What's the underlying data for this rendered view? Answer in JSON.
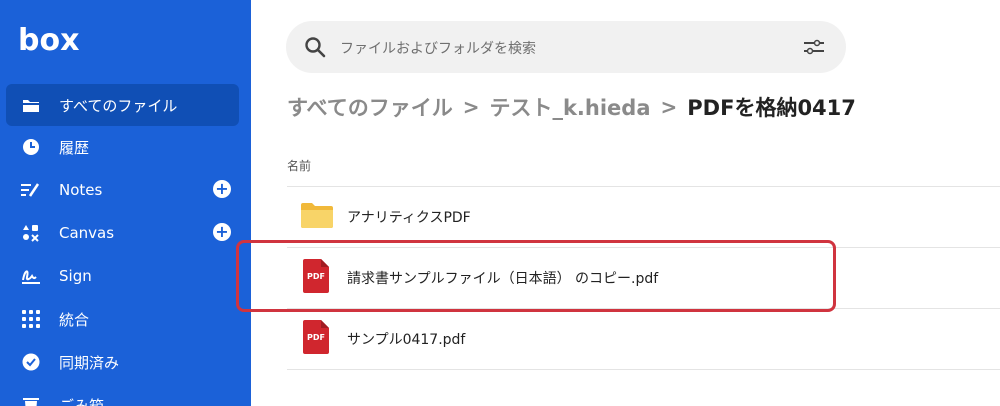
{
  "sidebar": {
    "logo": "box",
    "items": [
      {
        "label": "すべてのファイル",
        "icon": "folder-icon",
        "active": true
      },
      {
        "label": "履歴",
        "icon": "clock-icon"
      },
      {
        "label": "Notes",
        "icon": "notes-icon",
        "plus": "+"
      },
      {
        "label": "Canvas",
        "icon": "canvas-icon",
        "plus": "+"
      },
      {
        "label": "Sign",
        "icon": "sign-icon"
      },
      {
        "label": "統合",
        "icon": "grid-icon"
      },
      {
        "label": "同期済み",
        "icon": "check-circle-icon"
      },
      {
        "label": "ごみ箱",
        "icon": "trash-icon"
      }
    ]
  },
  "search": {
    "placeholder": "ファイルおよびフォルダを検索"
  },
  "breadcrumb": {
    "items": [
      "すべてのファイル",
      "テスト_k.hieda",
      "PDFを格納0417"
    ],
    "separator": ">"
  },
  "list": {
    "column_name": "名前",
    "files": [
      {
        "name": "アナリティクスPDF",
        "type": "folder"
      },
      {
        "name": "請求書サンプルファイル（日本語） のコピー.pdf",
        "type": "pdf",
        "badge": "PDF"
      },
      {
        "name": "サンプル0417.pdf",
        "type": "pdf",
        "badge": "PDF"
      }
    ]
  },
  "colors": {
    "sidebar_bg": "#1b61d8",
    "sidebar_active": "#104fb5",
    "highlight": "#d0343f",
    "pdf_red": "#d0262e",
    "folder_yellow": "#f5c84c"
  }
}
